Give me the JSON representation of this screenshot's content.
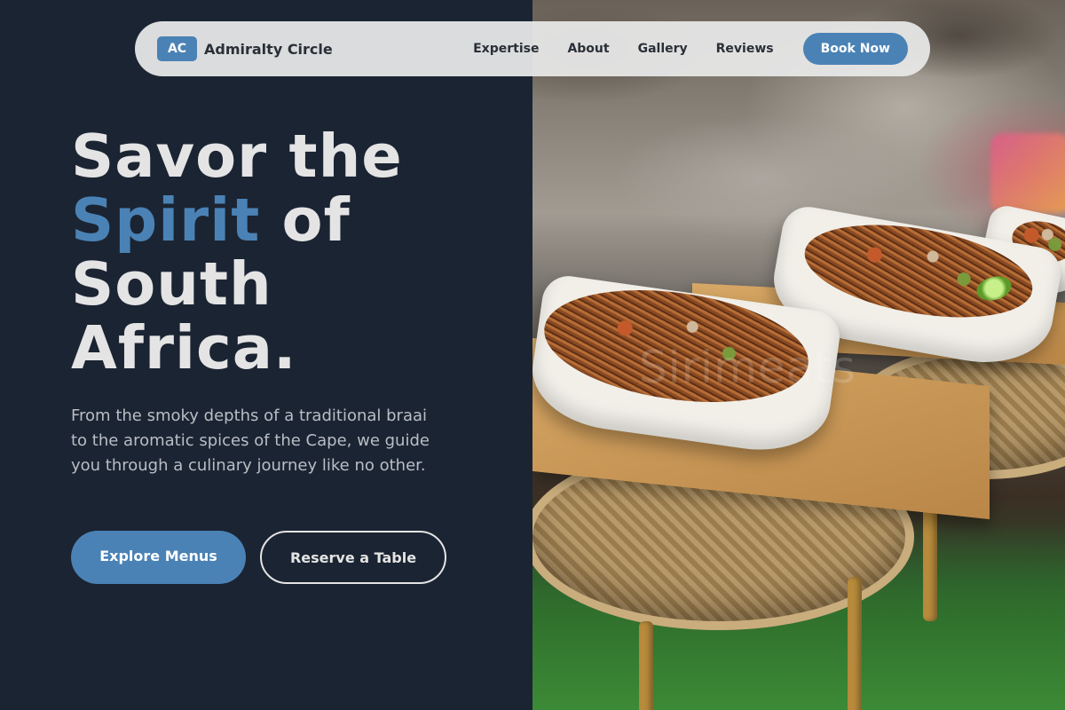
{
  "brand": {
    "logo_initials": "AC",
    "name": "Admiralty Circle"
  },
  "nav": {
    "links": [
      "Expertise",
      "About",
      "Gallery",
      "Reviews"
    ],
    "cta": "Book Now"
  },
  "hero": {
    "title_line1": "Savor the",
    "title_accent": "Spirit",
    "title_line2_rest": " of",
    "title_line3": "South",
    "title_line4": "Africa.",
    "subtitle": "From the smoky depths of a traditional braai to the aromatic spices of the Cape, we guide you through a culinary journey like no other.",
    "primary_button": "Explore Menus",
    "secondary_button": "Reserve a Table"
  },
  "photo": {
    "watermark": "Sirimeats"
  },
  "colors": {
    "background": "#1b2432",
    "accent": "#4a82b5",
    "nav_bg": "#e8e8e8",
    "heading": "#e4e4e4"
  }
}
